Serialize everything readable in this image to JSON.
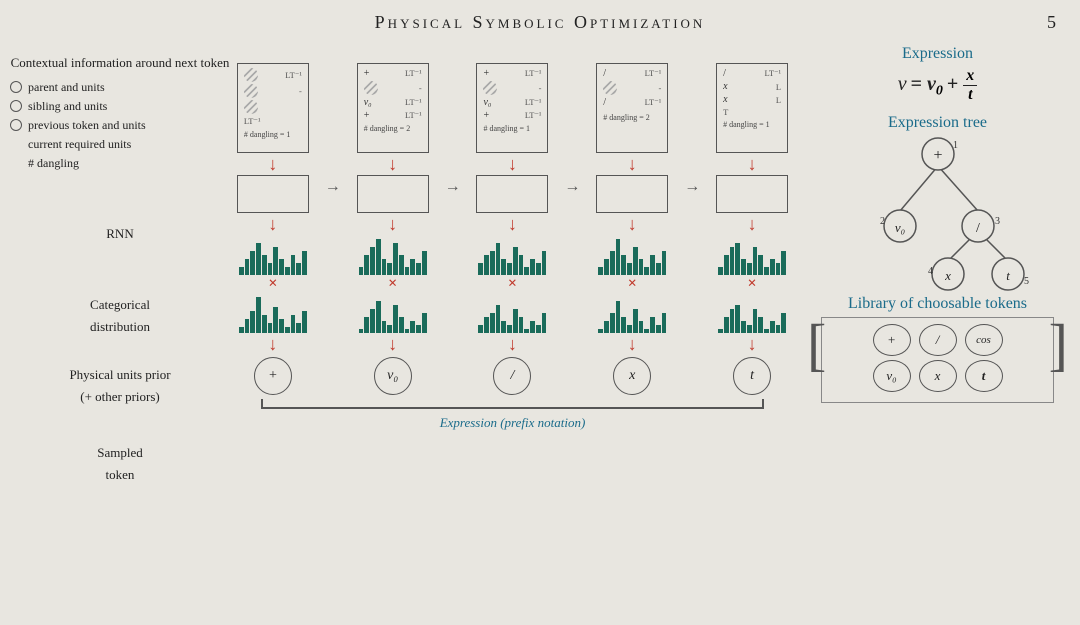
{
  "title": "Physical Symbolic Optimization",
  "page_number": "5",
  "left_panel": {
    "context_title": "Contextual information around next token",
    "items": [
      {
        "type": "radio",
        "label": "parent and units"
      },
      {
        "type": "radio",
        "label": "sibling and units"
      },
      {
        "type": "radio",
        "label": "previous token and units"
      },
      {
        "type": "plain",
        "label": "current required units"
      },
      {
        "type": "plain",
        "label": "# dangling"
      }
    ]
  },
  "labels": {
    "rnn": "RNN",
    "categorical": "Categorical",
    "distribution": "distribution",
    "physical_units": "Physical units prior",
    "other_priors": "(+ other priors)",
    "sampled": "Sampled",
    "token": "token",
    "expression_prefix": "Expression (prefix notation)"
  },
  "steps": [
    {
      "tokens": [
        {
          "sym": "striped",
          "unit": "LT⁻¹"
        },
        {
          "sym": "striped",
          "unit": "-"
        },
        {
          "sym": "striped",
          "unit": ""
        },
        {
          "sym": "",
          "unit": "LT⁻¹"
        }
      ],
      "dangling": "# dangling = 1",
      "result": "+",
      "bars_cat": [
        2,
        4,
        6,
        8,
        5,
        3,
        7,
        4,
        2,
        5,
        3,
        6
      ],
      "bars_prior": [
        1,
        3,
        5,
        9,
        4,
        2,
        6,
        3,
        1,
        4,
        2,
        5
      ]
    },
    {
      "tokens": [
        {
          "sym": "+",
          "unit": "LT⁻¹"
        },
        {
          "sym": "striped",
          "unit": "-"
        },
        {
          "sym": "v0",
          "unit": "LT⁻¹"
        },
        {
          "sym": "+",
          "unit": "LT⁻¹"
        }
      ],
      "dangling": "# dangling = 2",
      "result": "v₀",
      "bars_cat": [
        2,
        5,
        7,
        9,
        4,
        3,
        8,
        5,
        2,
        4,
        3,
        6
      ],
      "bars_prior": [
        1,
        4,
        6,
        8,
        3,
        2,
        7,
        4,
        1,
        3,
        2,
        5
      ]
    },
    {
      "tokens": [
        {
          "sym": "+",
          "unit": "LT⁻¹"
        },
        {
          "sym": "striped",
          "unit": "-"
        },
        {
          "sym": "v0",
          "unit": "LT⁻¹"
        },
        {
          "sym": "+",
          "unit": "LT⁻¹"
        }
      ],
      "dangling": "# dangling = 1",
      "result": "/",
      "bars_cat": [
        3,
        5,
        6,
        8,
        4,
        3,
        7,
        5,
        2,
        4,
        3,
        6
      ],
      "bars_prior": [
        2,
        4,
        5,
        7,
        3,
        2,
        6,
        4,
        1,
        3,
        2,
        5
      ]
    },
    {
      "tokens": [
        {
          "sym": "/",
          "unit": "LT⁻¹"
        },
        {
          "sym": "striped",
          "unit": "-"
        },
        {
          "sym": "/",
          "unit": "LT⁻¹"
        },
        {
          "sym": "",
          "unit": ""
        }
      ],
      "dangling": "# dangling = 2",
      "result": "x",
      "bars_cat": [
        2,
        4,
        6,
        9,
        5,
        3,
        7,
        4,
        2,
        5,
        3,
        6
      ],
      "bars_prior": [
        1,
        3,
        5,
        8,
        4,
        2,
        6,
        3,
        1,
        4,
        2,
        5
      ]
    },
    {
      "tokens": [
        {
          "sym": "/",
          "unit": "LT⁻¹"
        },
        {
          "sym": "x",
          "unit": "L"
        },
        {
          "sym": "x",
          "unit": "L"
        },
        {
          "sym": "",
          "unit": "T"
        }
      ],
      "dangling": "# dangling = 1",
      "result": "t",
      "bars_cat": [
        2,
        5,
        7,
        8,
        4,
        3,
        7,
        5,
        2,
        4,
        3,
        6
      ],
      "bars_prior": [
        1,
        4,
        6,
        7,
        3,
        2,
        6,
        4,
        1,
        3,
        2,
        5
      ]
    }
  ],
  "right_panel": {
    "expression_title": "Expression",
    "formula": "v = v₀ + x/t",
    "tree_title": "Expression tree",
    "library_title": "Library of choosable tokens",
    "library_tokens_row1": [
      "+",
      "/",
      "cos"
    ],
    "library_tokens_row2": [
      "v₀",
      "x",
      "t"
    ]
  }
}
